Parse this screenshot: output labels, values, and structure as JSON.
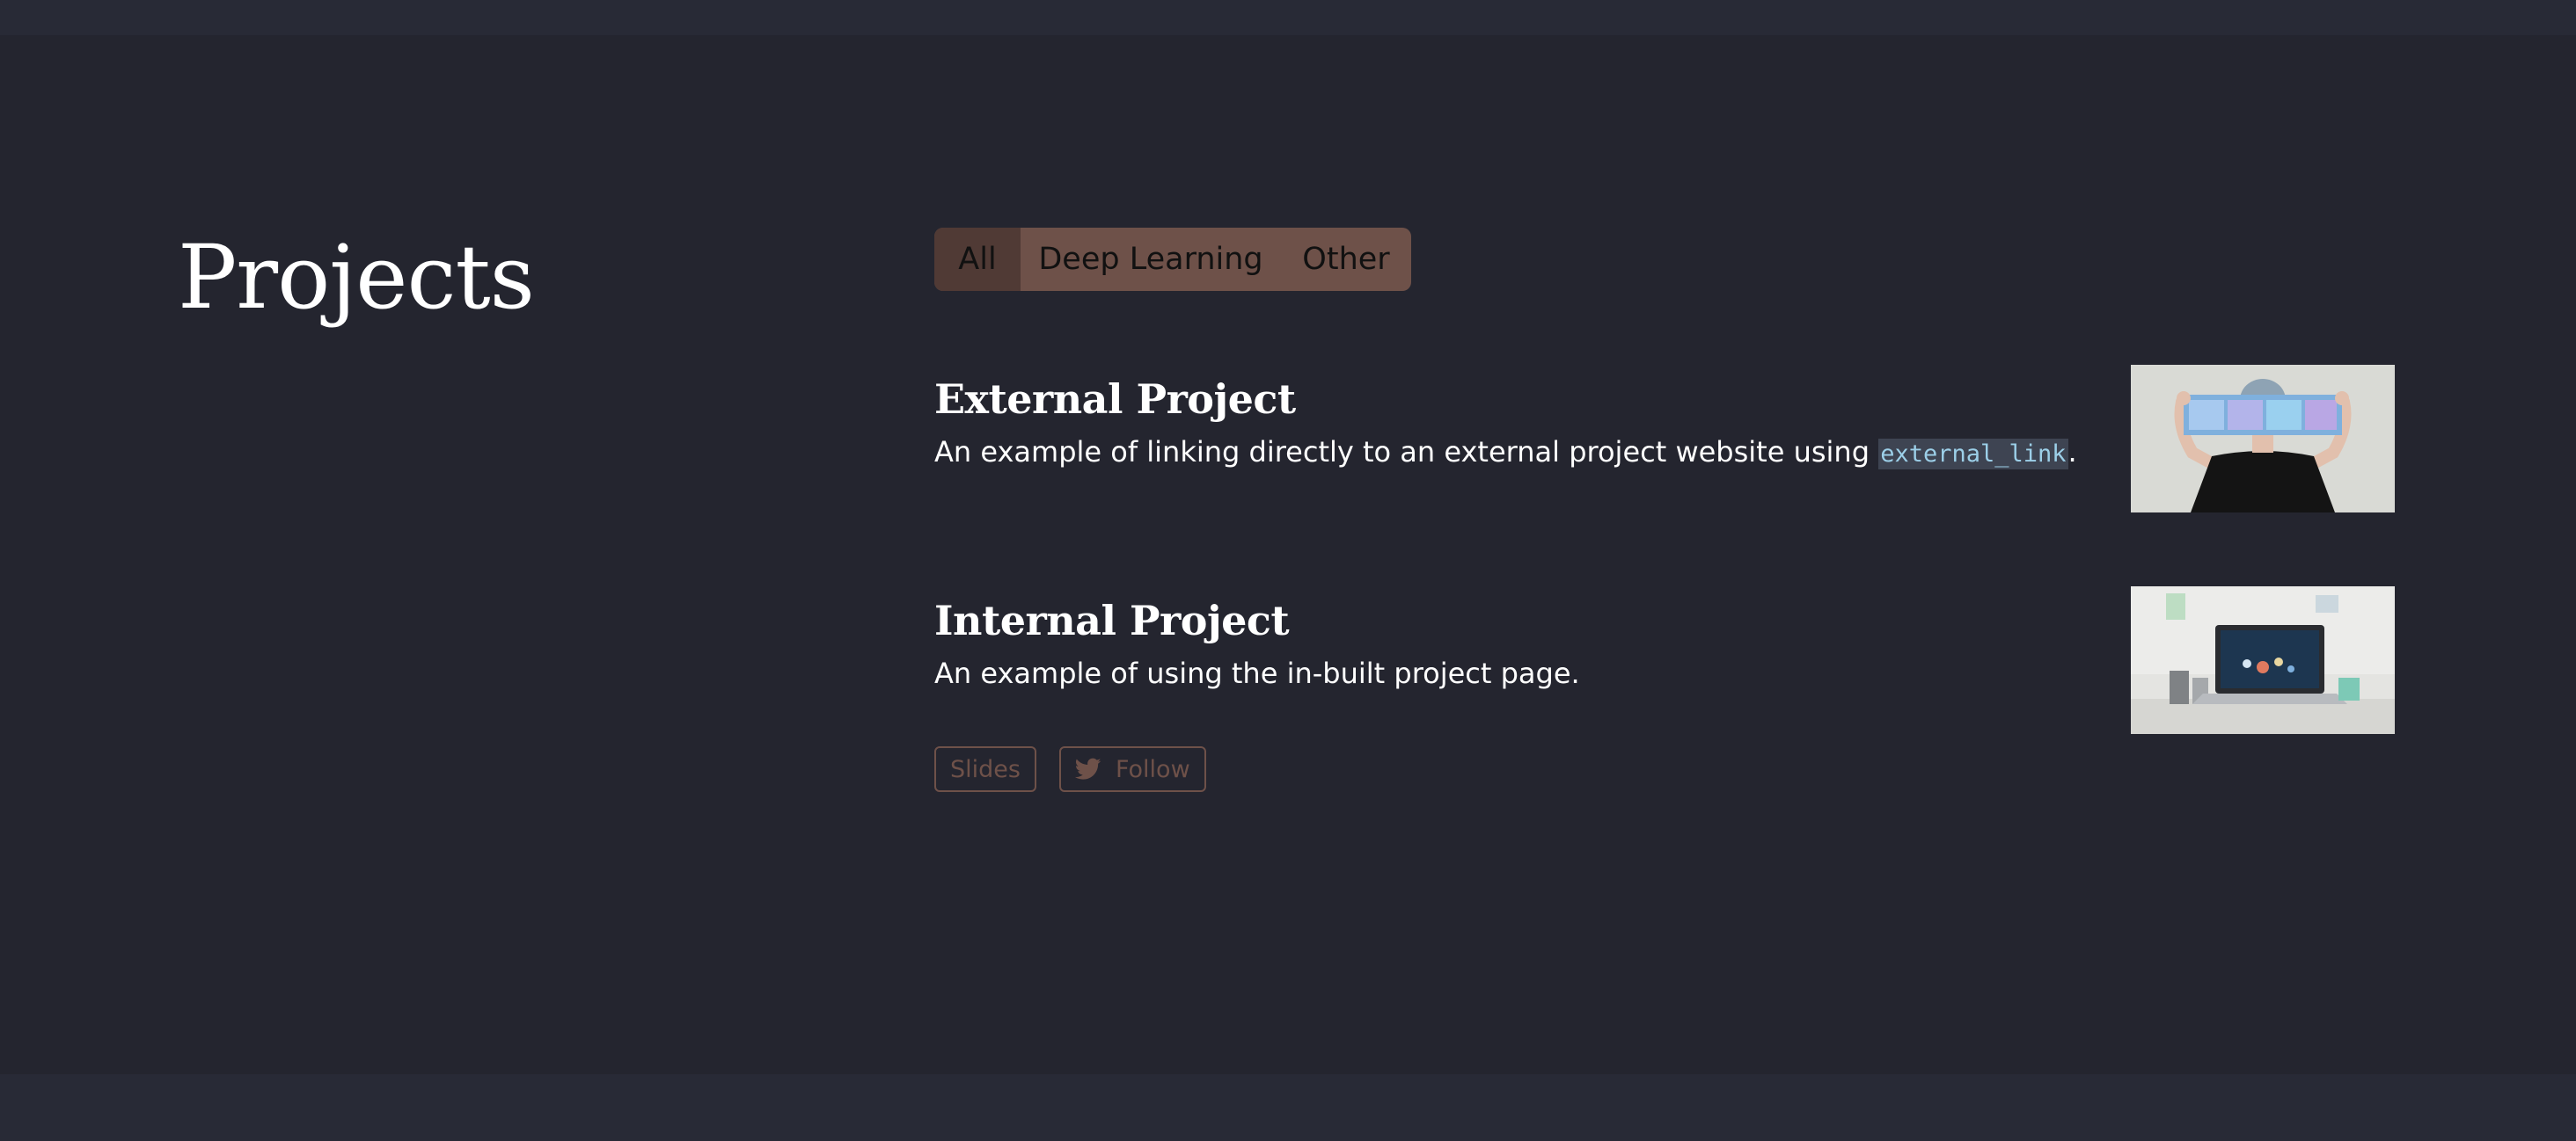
{
  "page": {
    "title": "Projects"
  },
  "filters": {
    "items": [
      {
        "label": "All",
        "active": true
      },
      {
        "label": "Deep Learning",
        "active": false
      },
      {
        "label": "Other",
        "active": false
      }
    ]
  },
  "projects": [
    {
      "title": "External Project",
      "description_prefix": "An example of linking directly to an external project website using ",
      "description_code": "external_link",
      "description_suffix": ".",
      "thumbnail_icon": "person-holding-paper-photo"
    },
    {
      "title": "Internal Project",
      "description": "An example of using the in-built project page.",
      "thumbnail_icon": "laptop-on-desk-photo",
      "buttons": {
        "slides_label": "Slides",
        "follow_label": "Follow",
        "follow_icon": "twitter-icon"
      }
    }
  ],
  "colors": {
    "background": "#24252f",
    "accent": "#6e5149",
    "accent_active": "#503a35",
    "code_text": "#9ccfe8"
  }
}
